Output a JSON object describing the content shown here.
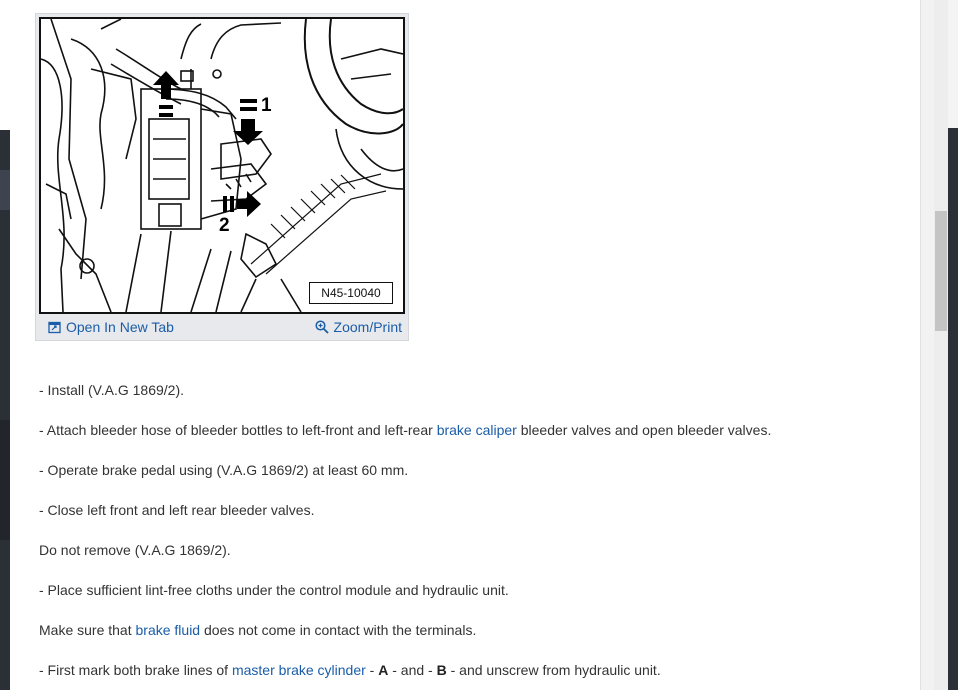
{
  "figure": {
    "code": "N45-10040",
    "callout_1": "1",
    "callout_2": "2",
    "open_new_tab": "Open In New Tab",
    "zoom_print": "Zoom/Print"
  },
  "steps": [
    {
      "text": "-  Install (V.A.G 1869/2)."
    },
    {
      "pre": "-  Attach bleeder hose of bleeder bottles to left-front and left-rear ",
      "link": "brake caliper",
      "post": " bleeder valves and open bleeder valves."
    },
    {
      "text": "-  Operate brake pedal using (V.A.G 1869/2) at least 60 mm."
    },
    {
      "text": "-  Close left front and left rear bleeder valves."
    },
    {
      "text": "Do not remove (V.A.G 1869/2)."
    },
    {
      "text": "-  Place sufficient lint-free cloths under the control module and hydraulic unit."
    },
    {
      "pre": "Make sure that ",
      "link": "brake fluid",
      "post": " does not come in contact with the terminals."
    },
    {
      "pre": "-  First mark both brake lines of ",
      "link": "master brake cylinder",
      "mid1": " - ",
      "bold1": "A",
      "mid2": " - and - ",
      "bold2": "B",
      "post": " - and unscrew from hydraulic unit."
    }
  ]
}
